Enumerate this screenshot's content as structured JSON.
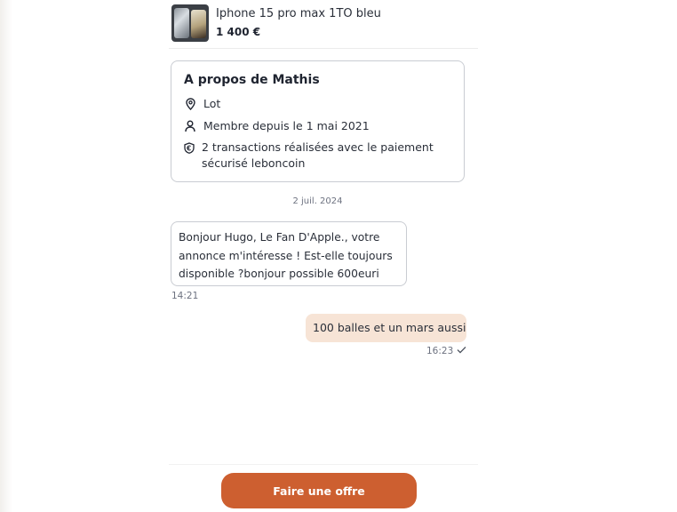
{
  "product": {
    "title": "Iphone 15 pro max 1TO bleu",
    "price": "1 400 €"
  },
  "about": {
    "title": "A propos de Mathis",
    "location": "Lot",
    "member_since": "Membre depuis le 1 mai 2021",
    "transactions": "2 transactions réalisées avec le paiement sécurisé leboncoin"
  },
  "conversation": {
    "date": "2 juil. 2024",
    "messages": [
      {
        "direction": "incoming",
        "text": "Bonjour Hugo, Le Fan D'Apple., votre annonce m'intéresse ! Est-elle toujours disponible ?bonjour possible 600euri",
        "time": "14:21"
      },
      {
        "direction": "outgoing",
        "text": "100 balles et un mars aussi",
        "time": "16:23",
        "status_icon": "check-icon"
      }
    ]
  },
  "actions": {
    "offer_label": "Faire une offre"
  },
  "colors": {
    "accent": "#cd5f30",
    "outgoing_bubble": "#f7e4d6",
    "border": "#c9ccd2"
  }
}
